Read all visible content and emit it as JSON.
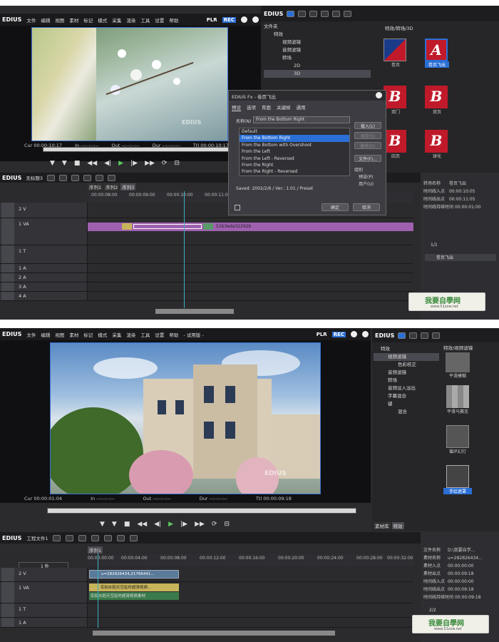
{
  "s1": {
    "app": "EDIUS",
    "menus": [
      "文件",
      "编辑",
      "视图",
      "素材",
      "标记",
      "模式",
      "采集",
      "渲染",
      "工具",
      "设置",
      "帮助"
    ],
    "plr": "PLR",
    "rec": "REC",
    "preview": {
      "cur": "Cur 00:00:10:17",
      "in": "In --:--:--:--",
      "out": "Out --:--:--:--",
      "dur": "Dur --:--:--:--",
      "ttl": "Ttl 00:00:10:17",
      "watermark": "EDIUS"
    },
    "bin": {
      "logo": "EDIUS",
      "folder_label": "文件夹",
      "path": "特效/转场/3D",
      "tree": [
        "特效",
        "视频滤镜",
        "音频滤镜",
        "转场",
        "2D",
        "3D"
      ],
      "thumbs": [
        "卷页",
        "卷页飞出",
        "双门",
        "双页",
        "四页",
        "球化"
      ]
    },
    "dialog": {
      "title": "EDIUS Fx - 卷页飞出",
      "tabs": [
        "预设",
        "选项",
        "背面",
        "关键帧",
        "通用"
      ],
      "name_label": "名称(N)",
      "name_value": "From the Bottom Right",
      "items": [
        "Default",
        "From the Bottom Right",
        "From the Bottom with Overshoot",
        "From the Left",
        "From the Left - Reversed",
        "From the Right",
        "From the Right - Reversed"
      ],
      "buttons": [
        "载入(L)",
        "保存(S)",
        "删除(D)",
        "文件(F)..."
      ],
      "group_label": "组别",
      "radios": [
        "预设(P)",
        "用户(U)"
      ],
      "saved": "Saved: 2002/2/6 / Ver.: 1.01 / Preset",
      "ok": "确定",
      "cancel": "取消"
    },
    "timeline": {
      "logo": "EDIUS",
      "project": "无标题3",
      "seqs": [
        "序列1",
        "序列2",
        "序列3"
      ],
      "ruler": [
        "00:00:08:00",
        "00:00:09:00",
        "00:00:10:00",
        "00:00:11:00"
      ],
      "tracks": [
        "2 V",
        "1 VA",
        "1 T",
        "1 A",
        "2 A",
        "3 A",
        "4 A"
      ],
      "clip": "51b3eda32292b"
    },
    "info": {
      "rows": [
        [
          "转场名称",
          "卷页飞出"
        ],
        [
          "时间线入点",
          "00:00:10:05"
        ],
        [
          "时间线出点",
          "00:00:11:05"
        ],
        [
          "时间线持续时间",
          "00:00:01:00"
        ]
      ],
      "page": "1/1",
      "item": "卷页飞出"
    },
    "wm": {
      "big": "我要自學网",
      "small": "www.51zxw.net"
    }
  },
  "s2": {
    "app": "EDIUS",
    "menus": [
      "文件",
      "编辑",
      "视图",
      "素材",
      "标记",
      "模式",
      "采集",
      "渲染",
      "工具",
      "设置",
      "帮助",
      "- 试用版 -"
    ],
    "plr": "PLR",
    "rec": "REC",
    "preview": {
      "cur": "Cur 00:00:01:04",
      "in": "In --:--:--:--",
      "out": "Out --:--:--:--",
      "dur": "Dur --:--:--:--",
      "ttl": "Ttl 00:00:09:18",
      "watermark": "EDIUS"
    },
    "bin": {
      "logo": "EDIUS",
      "path": "特效/视频滤镜",
      "tree": [
        "特效",
        "视频滤镜",
        "色彩校正",
        "音频滤镜",
        "转场",
        "音频淡入淡出",
        "字幕混合",
        "键",
        "混合"
      ],
      "thumbs": [
        "平滑模糊",
        "平滑马赛克",
        "循环幻灯",
        "手绘遮罩"
      ],
      "tabs": [
        "素材库",
        "特效"
      ]
    },
    "timeline": {
      "logo": "EDIUS",
      "project": "工程文件1",
      "seq": "序列1",
      "zoom": "1 秒",
      "ruler": [
        "00:00:00:00",
        "00:00:04:00",
        "00:00:08:00",
        "00:00:12:00",
        "00:00:16:00",
        "00:00:20:00",
        "00:00:24:00",
        "00:00:28:00",
        "00:00:32:00"
      ],
      "tracks": [
        "2 V",
        "1 VA",
        "1 T",
        "1 A"
      ],
      "clip_v": "u=282826434,21766441...",
      "clip_va1": "实拍水稻天空延时超清视频...",
      "clip_va2": "实拍水稻天空延时超清视频素材"
    },
    "info": {
      "rows": [
        [
          "文件名称",
          "D:\\我要自学..."
        ],
        [
          "素材名称",
          "u=282826434..."
        ],
        [
          "素材入点",
          "00:00:00:00"
        ],
        [
          "素材出点",
          "00:00:09:18"
        ],
        [
          "时间线入点",
          "00:00:00:00"
        ],
        [
          "时间线出点",
          "00:00:09:18"
        ],
        [
          "时间线持续时间",
          "00:00:09:18"
        ]
      ],
      "page": "2/2"
    },
    "wm": {
      "big": "我要自學网",
      "small": "www.51zxw.net"
    }
  },
  "colors": {
    "accent": "#2a6fd6",
    "clip_purple": "#a060b0",
    "clip_green": "#3b7a4a",
    "clip_yellow": "#c8b45a"
  }
}
